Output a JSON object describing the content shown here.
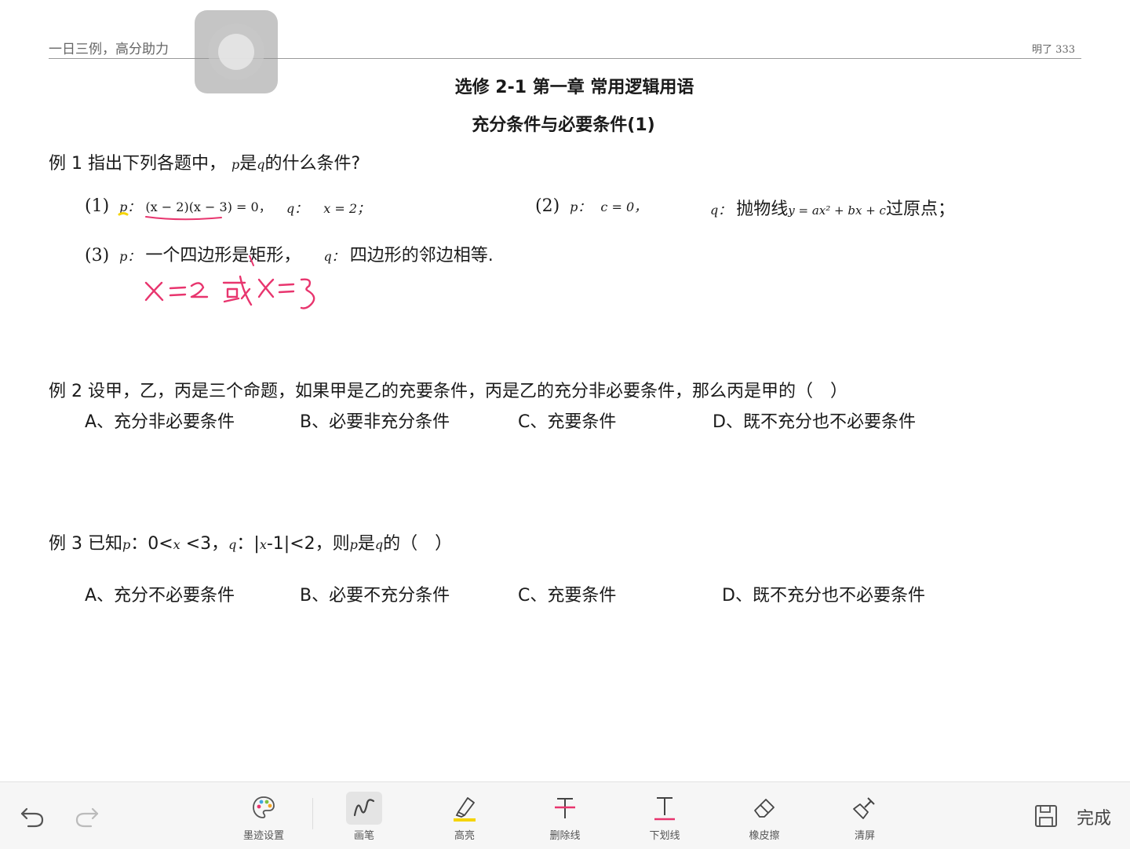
{
  "header": {
    "left": "一日三例，高分助力",
    "right": "明了 333"
  },
  "doc": {
    "title": "选修 2-1 第一章 常用逻辑用语",
    "subtitle": "充分条件与必要条件(1)",
    "ex1": {
      "prompt_a": "例 1 指出下列各题中，",
      "p": "p",
      "prompt_b": "是",
      "q": "q",
      "prompt_c": "的什么条件?",
      "i1_num": "(1)",
      "i1_p": "p：",
      "i1_pexpr": "(x − 2)(x − 3) = 0，",
      "i1_q": "q：",
      "i1_qexpr": "x = 2；",
      "i2_num": "(2)",
      "i2_p": "p：",
      "i2_pexpr": "c = 0，",
      "i2_q": "q：",
      "i2_qtext": "抛物线",
      "i2_qexpr": "y = ax² + bx + c",
      "i2_qtail": "过原点；",
      "i3_num": "(3)",
      "i3_p": "p：",
      "i3_ptext": "一个四边形是矩形，",
      "i3_q": "q：",
      "i3_qtext": "四边形的邻边相等."
    },
    "ex2": {
      "stem": "例 2 设甲，乙，丙是三个命题，如果甲是乙的充要条件，丙是乙的充分非必要条件，那么丙是甲的（　）",
      "optA": "A、充分非必要条件",
      "optB": "B、必要非充分条件",
      "optC": "C、充要条件",
      "optD": "D、既不充分也不必要条件"
    },
    "ex3": {
      "a": "例 3 已知",
      "p": "p",
      "b": "：0<",
      "x1": "x",
      "c": " <3，",
      "q": "q",
      "d": "：|",
      "x2": "x",
      "e": "-1|<2，则",
      "p2": "p",
      "f": "是",
      "q2": "q",
      "g": "的（　）",
      "optA": "A、充分不必要条件",
      "optB": "B、必要不充分条件",
      "optC": "C、充要条件",
      "optD": "D、既不充分也不必要条件"
    }
  },
  "ink_color": "#e8356e",
  "highlight_color": "#f5d400",
  "toolbar": {
    "undo": "undo-icon",
    "redo": "redo-icon",
    "tools": [
      {
        "label": "墨迹设置",
        "icon": "palette-icon"
      },
      {
        "label": "画笔",
        "icon": "pen-icon",
        "active": true
      },
      {
        "label": "高亮",
        "icon": "highlighter-icon"
      },
      {
        "label": "删除线",
        "icon": "strikethrough-icon"
      },
      {
        "label": "下划线",
        "icon": "underline-icon"
      },
      {
        "label": "橡皮擦",
        "icon": "eraser-icon"
      },
      {
        "label": "清屏",
        "icon": "clear-screen-icon"
      }
    ],
    "save": "save-icon",
    "done": "完成"
  }
}
